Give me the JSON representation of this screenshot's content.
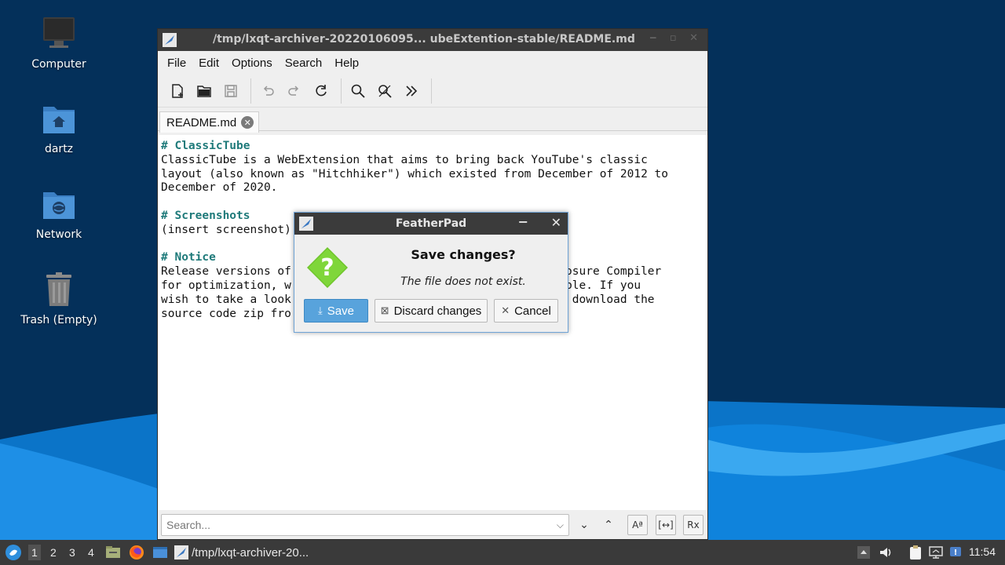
{
  "desktop": {
    "icons": [
      {
        "label": "Computer"
      },
      {
        "label": "dartz"
      },
      {
        "label": "Network"
      },
      {
        "label": "Trash (Empty)"
      }
    ]
  },
  "window": {
    "title": "/tmp/lxqt-archiver-20220106095... ubeExtention-stable/README.md",
    "menu": [
      "File",
      "Edit",
      "Options",
      "Search",
      "Help"
    ],
    "tab_label": "README.md",
    "editor_lines": [
      {
        "text": "# ClassicTube",
        "heading": true
      },
      {
        "text": "ClassicTube is a WebExtension that aims to bring back YouTube's classic",
        "heading": false
      },
      {
        "text": "layout (also known as \"Hitchhiker\") which existed from December of 2012 to",
        "heading": false
      },
      {
        "text": "December of 2020.",
        "heading": false
      },
      {
        "text": "",
        "heading": false
      },
      {
        "text": "# Screenshots",
        "heading": true
      },
      {
        "text": "(insert screenshot)",
        "heading": false
      },
      {
        "text": "",
        "heading": false
      },
      {
        "text": "# Notice",
        "heading": true
      },
      {
        "text": "Release versions of                                    s Closure Compiler",
        "heading": false
      },
      {
        "text": "for optimization, w                                    eadable. If you",
        "heading": false
      },
      {
        "text": "wish to take a look                                    o or download the",
        "heading": false
      },
      {
        "text": "source code zip fro",
        "heading": false
      }
    ],
    "search_placeholder": "Search..."
  },
  "dialog": {
    "title": "FeatherPad",
    "headline": "Save changes?",
    "message": "The file does not exist.",
    "save_label": "Save",
    "discard_label": "Discard changes",
    "cancel_label": "Cancel"
  },
  "taskbar": {
    "desktops": [
      "1",
      "2",
      "3",
      "4"
    ],
    "active_desktop": "1",
    "task_label": "/tmp/lxqt-archiver-20...",
    "clock": "11:54"
  },
  "colors": {
    "accent": "#58a3dc",
    "heading": "#1f7a7a",
    "titlebar": "#3b3b3b"
  }
}
